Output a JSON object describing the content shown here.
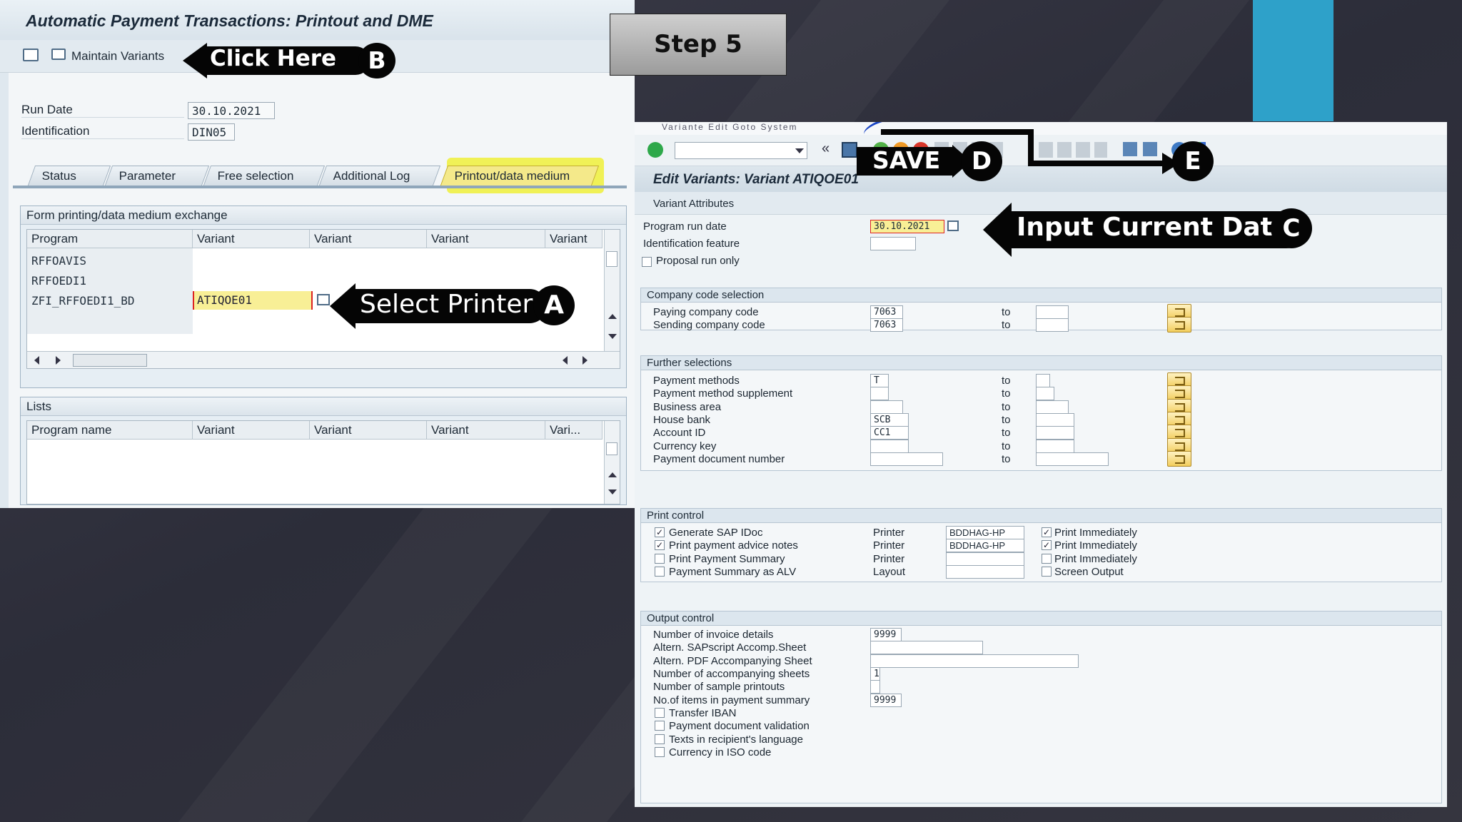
{
  "left": {
    "title": "Automatic Payment Transactions: Printout and DME",
    "toolbar": {
      "maintain_variants": "Maintain Variants"
    },
    "run_date_label": "Run Date",
    "run_date_value": "30.10.2021",
    "identification_label": "Identification",
    "identification_value": "DIN05",
    "tabs": [
      "Status",
      "Parameter",
      "Free selection",
      "Additional Log",
      "Printout/data medium"
    ],
    "form_panel_title": "Form printing/data medium exchange",
    "form_columns": [
      "Program",
      "Variant",
      "Variant",
      "Variant",
      "Variant"
    ],
    "form_rows": [
      {
        "program": "RFFOAVIS",
        "variant": ""
      },
      {
        "program": "RFFOEDI1",
        "variant": ""
      },
      {
        "program": "ZFI_RFFOEDI1_BD",
        "variant": "ATIQOE01"
      }
    ],
    "lists_panel_title": "Lists",
    "lists_columns": [
      "Program name",
      "Variant",
      "Variant",
      "Variant",
      "Vari..."
    ]
  },
  "step_box": "Step 5",
  "right": {
    "menu_text": "Variante  Edit  Goto  System",
    "title": "Edit Variants: Variant ATIQOE01",
    "subtitle": "Variant Attributes",
    "program_run_date_label": "Program run date",
    "program_run_date_value": "30.10.2021",
    "identification_feature_label": "Identification feature",
    "proposal_run_label": "Proposal run only",
    "company_section": {
      "title": "Company code selection",
      "rows": [
        {
          "label": "Paying company code",
          "value": "7063",
          "to": "to"
        },
        {
          "label": "Sending company code",
          "value": "7063",
          "to": "to"
        }
      ]
    },
    "further_section": {
      "title": "Further selections",
      "rows": [
        {
          "label": "Payment methods",
          "value": "T",
          "to": "to"
        },
        {
          "label": "Payment method supplement",
          "value": "",
          "to": "to"
        },
        {
          "label": "Business area",
          "value": "",
          "to": "to"
        },
        {
          "label": "House bank",
          "value": "SCB",
          "to": "to"
        },
        {
          "label": "Account ID",
          "value": "CC1",
          "to": "to"
        },
        {
          "label": "Currency key",
          "value": "",
          "to": "to"
        },
        {
          "label": "Payment document number",
          "value": "",
          "to": "to"
        }
      ]
    },
    "print_section": {
      "title": "Print control",
      "rows": [
        {
          "label": "Generate SAP IDoc",
          "checked": true,
          "kind": "Printer",
          "value": "BDDHAG-HP",
          "opt": "Print Immediately",
          "opt_checked": true
        },
        {
          "label": "Print payment advice notes",
          "checked": true,
          "kind": "Printer",
          "value": "BDDHAG-HP",
          "opt": "Print Immediately",
          "opt_checked": true
        },
        {
          "label": "Print Payment Summary",
          "checked": false,
          "kind": "Printer",
          "value": "",
          "opt": "Print Immediately",
          "opt_checked": false
        },
        {
          "label": "Payment Summary as ALV",
          "checked": false,
          "kind": "Layout",
          "value": "",
          "opt": "Screen Output",
          "opt_checked": false
        }
      ]
    },
    "output_section": {
      "title": "Output control",
      "rows": [
        {
          "label": "Number of invoice details",
          "value": "9999"
        },
        {
          "label": "Altern. SAPscript Accomp.Sheet",
          "value": ""
        },
        {
          "label": "Altern. PDF Accompanying Sheet",
          "value": ""
        },
        {
          "label": "Number of accompanying sheets",
          "value": "1"
        },
        {
          "label": "Number of sample printouts",
          "value": ""
        },
        {
          "label": "No.of items in payment summary",
          "value": "9999"
        }
      ],
      "checks": [
        "Transfer IBAN",
        "Payment document validation",
        "Texts in recipient's language",
        "Currency in ISO code"
      ]
    }
  },
  "annotations": {
    "click_here": "Click Here",
    "b": "B",
    "select_printer": "Select Printer",
    "a": "A",
    "save": "SAVE",
    "d": "D",
    "e": "E",
    "input_date": "Input Current Date",
    "c": "C"
  },
  "colors": {
    "accent_stripe": "#2ea1c9",
    "highlight": "#f4e98a",
    "background": "#33343f"
  }
}
